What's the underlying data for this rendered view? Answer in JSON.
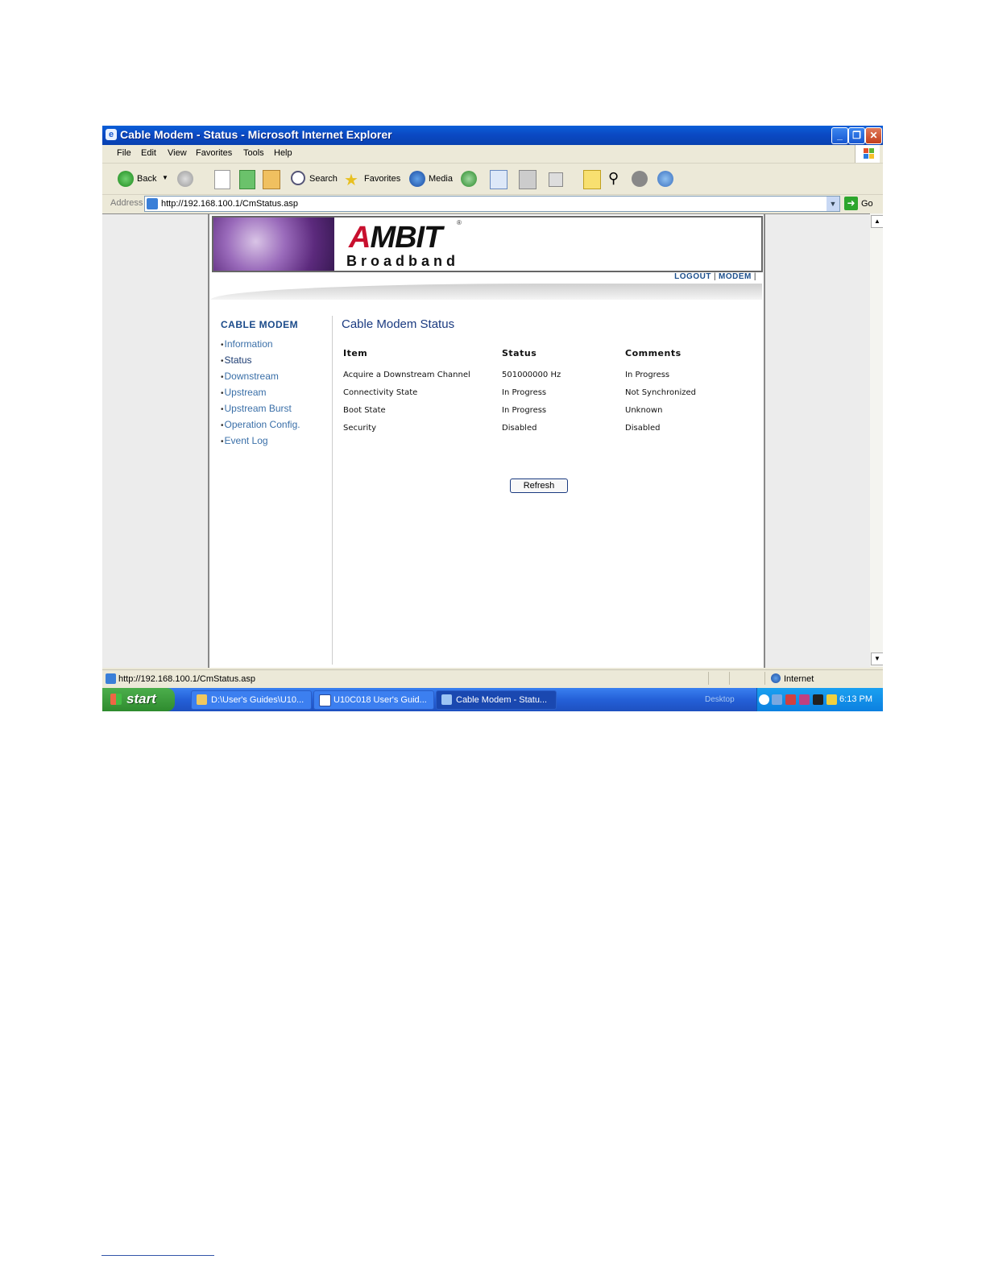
{
  "window": {
    "title": "Cable Modem - Status - Microsoft Internet Explorer"
  },
  "menu": [
    "File",
    "Edit",
    "View",
    "Favorites",
    "Tools",
    "Help"
  ],
  "toolbar": {
    "back": "Back",
    "search": "Search",
    "favorites": "Favorites",
    "media": "Media"
  },
  "address": {
    "label": "Address",
    "url": "http://192.168.100.1/CmStatus.asp",
    "go": "Go"
  },
  "banner": {
    "brand_main": "AMBIT",
    "brand_sub": "Broadband",
    "reg": "®"
  },
  "top_links": [
    "LOGOUT",
    "MODEM"
  ],
  "nav": {
    "heading": "CABLE MODEM",
    "items": [
      "Information",
      "Status",
      "Downstream",
      "Upstream",
      "Upstream Burst",
      "Operation Config.",
      "Event Log"
    ]
  },
  "main": {
    "title": "Cable Modem Status",
    "columns": [
      "Item",
      "Status",
      "Comments"
    ],
    "rows": [
      [
        "Acquire a Downstream Channel",
        "501000000 Hz",
        "In Progress"
      ],
      [
        "Connectivity State",
        "In Progress",
        "Not Synchronized"
      ],
      [
        "Boot State",
        "In Progress",
        "Unknown"
      ],
      [
        "Security",
        "Disabled",
        "Disabled"
      ]
    ],
    "refresh_label": "Refresh"
  },
  "statusbar": {
    "url": "http://192.168.100.1/CmStatus.asp",
    "zone": "Internet"
  },
  "taskbar": {
    "start": "start",
    "tasks": [
      "D:\\User's Guides\\U10...",
      "U10C018 User's Guid...",
      "Cable Modem - Statu..."
    ],
    "desktop": "Desktop",
    "clock": "6:13 PM"
  },
  "colors": {
    "title_blue": "#0b49c4",
    "nav_link": "#3a6fa8",
    "heading_navy": "#1a3a80",
    "taskbar_blue": "#2460d8",
    "start_green": "#2e8b2e"
  }
}
